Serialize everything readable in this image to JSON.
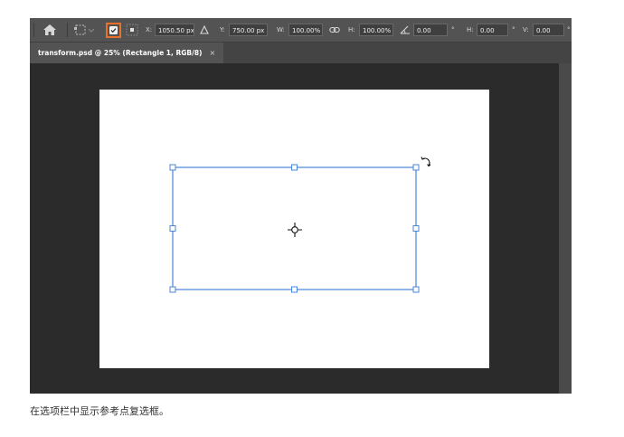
{
  "optionsBar": {
    "x_label": "X:",
    "x_value": "1050.50 px",
    "y_label": "Y:",
    "y_value": "750.00 px",
    "w_label": "W:",
    "w_value": "100.00%",
    "h_label": "H:",
    "h_value": "100.00%",
    "angle_value": "0.00",
    "angle_unit": "°",
    "hskew_label": "H:",
    "hskew_value": "0.00",
    "hskew_unit": "°",
    "vskew_label": "V:",
    "vskew_value": "0.00",
    "vskew_unit": "°",
    "reference_point_checkbox_checked": true,
    "highlight_color": "#e8702a"
  },
  "document": {
    "tab_title": "transform.psd @ 25% (Rectangle 1, RGB/8)",
    "tab_close": "×"
  },
  "selection": {
    "stroke_color": "#4a86d6"
  },
  "icons": [
    "home-icon",
    "reference-point-grid-icon",
    "delta-icon",
    "link-icon",
    "angle-icon",
    "rotate-icon",
    "reference-point-crosshair-icon"
  ],
  "caption": "在选项栏中显示参考点复选框。"
}
